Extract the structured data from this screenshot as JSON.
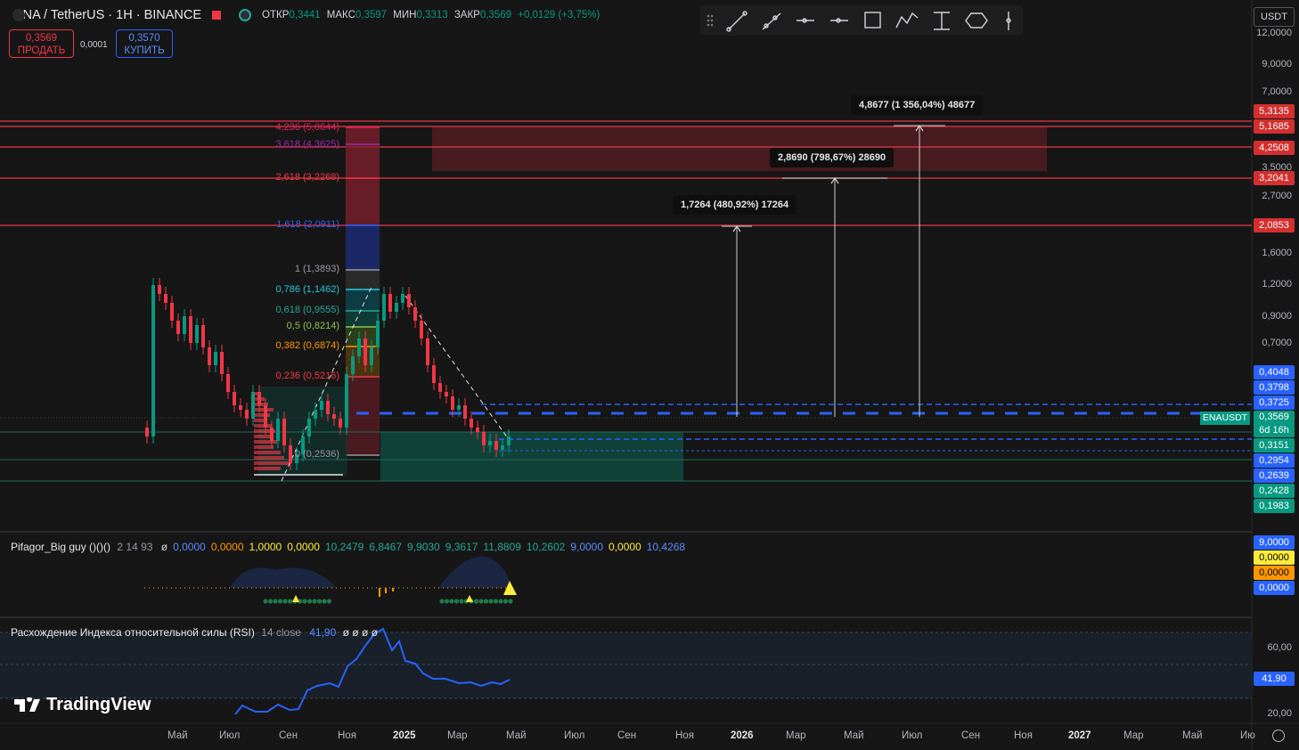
{
  "header": {
    "symbol": "ENA / TetherUS · 1H · BINANCE",
    "open_label": "ОТКР",
    "open": "0,3441",
    "high_label": "МАКС",
    "high": "0,3597",
    "low_label": "МИН",
    "low": "0,3313",
    "close_label": "ЗАКР",
    "close": "0,3569",
    "change": "+0,0129 (+3,75%)"
  },
  "trade": {
    "sell_price": "0,3569",
    "sell_label": "ПРОДАТЬ",
    "spread": "0,0001",
    "buy_price": "0,3570",
    "buy_label": "КУПИТЬ"
  },
  "currency": "USDT",
  "toolbar": [
    "drag-handle-icon",
    "trend-line-icon",
    "ray-icon",
    "horizontal-ray-icon",
    "horizontal-line-icon",
    "rectangle-icon",
    "path-icon",
    "fib-icon",
    "ellipse-icon",
    "vertical-line-icon"
  ],
  "price_axis": {
    "labels": [
      "12,0000",
      "9,0000",
      "7,0000",
      "3,5000",
      "2,7000",
      "1,6000",
      "1,2000",
      "0,9000",
      "0,7000"
    ],
    "tags_red": [
      "5,3135",
      "5,1685",
      "4,2508",
      "3,2041",
      "2,0853"
    ],
    "tags_blue": [
      "0,4048",
      "0,3798",
      "0,3725"
    ],
    "last_price": "0,3569",
    "countdown": "6d 16h",
    "tags_green": [
      "0,3151"
    ],
    "tags_blue2": [
      "0,2954",
      "0,2639"
    ],
    "tags_green2": [
      "0,2428",
      "0,1983"
    ],
    "symbol_tag": "ENAUSDT"
  },
  "callouts": [
    "4,8677 (1 356,04%) 48677",
    "2,8690 (798,67%) 28690",
    "1,7264 (480,92%) 17264"
  ],
  "fib_levels": [
    {
      "label": "4,236 (5,0644)",
      "color": "#e91e63"
    },
    {
      "label": "3,618 (4,3625)",
      "color": "#9c27b0"
    },
    {
      "label": "2,618 (3,2268)",
      "color": "#f23645"
    },
    {
      "label": "1,618 (2,0911)",
      "color": "#2962ff"
    },
    {
      "label": "1 (1,3893)",
      "color": "#9598a1"
    },
    {
      "label": "0,786 (1,1462)",
      "color": "#26c6da"
    },
    {
      "label": "0,618 (0,9555)",
      "color": "#26a69a"
    },
    {
      "label": "0,5 (0,8214)",
      "color": "#8bc34a"
    },
    {
      "label": "0,382 (0,6874)",
      "color": "#ff9800"
    },
    {
      "label": "0,236 (0,5216)",
      "color": "#f23645"
    },
    {
      "label": "0 (0,2536)",
      "color": "#9598a1"
    }
  ],
  "indicator1": {
    "name": "Pifagor_Big guy ()()()",
    "params": "2 14 93",
    "values": [
      {
        "v": "ø",
        "c": "#d1d4dc"
      },
      {
        "v": "0,0000",
        "c": "#5b8cff"
      },
      {
        "v": "0,0000",
        "c": "#ff9800"
      },
      {
        "v": "1,0000",
        "c": "#ffeb3b"
      },
      {
        "v": "0,0000",
        "c": "#ffeb3b"
      },
      {
        "v": "10,2479",
        "c": "#26a69a"
      },
      {
        "v": "6,8467",
        "c": "#26a69a"
      },
      {
        "v": "9,9030",
        "c": "#26a69a"
      },
      {
        "v": "9,3617",
        "c": "#26a69a"
      },
      {
        "v": "11,8809",
        "c": "#26a69a"
      },
      {
        "v": "10,2602",
        "c": "#26a69a"
      },
      {
        "v": "9,0000",
        "c": "#5b8cff"
      },
      {
        "v": "0,0000",
        "c": "#ffeb3b"
      },
      {
        "v": "10,4268",
        "c": "#5b8cff"
      }
    ],
    "axis_tags": [
      {
        "v": "9,0000",
        "bg": "#2962ff",
        "fg": "#ffffff"
      },
      {
        "v": "0,0000",
        "bg": "#ffeb3b",
        "fg": "#000000"
      },
      {
        "v": "0,0000",
        "bg": "#ff9800",
        "fg": "#000000"
      },
      {
        "v": "0,0000",
        "bg": "#2962ff",
        "fg": "#ffffff"
      }
    ]
  },
  "indicator2": {
    "name": "Расхождение Индекса относительной силы (RSI)",
    "params": "14 close",
    "value": "41,90",
    "extras": "ø ø ø ø",
    "axis": [
      "60,00",
      "20,00"
    ],
    "tag": "41,90"
  },
  "time_axis": [
    "Май",
    "Июл",
    "Сен",
    "Ноя",
    "2025",
    "Мар",
    "Май",
    "Июл",
    "Сен",
    "Ноя",
    "2026",
    "Мар",
    "Май",
    "Июл",
    "Сен",
    "Ноя",
    "2027",
    "Мар",
    "Май",
    "Ию"
  ],
  "branding": "TradingView",
  "colors": {
    "up": "#089981",
    "down": "#f23645",
    "accent": "#2962ff",
    "bg": "#161616"
  }
}
